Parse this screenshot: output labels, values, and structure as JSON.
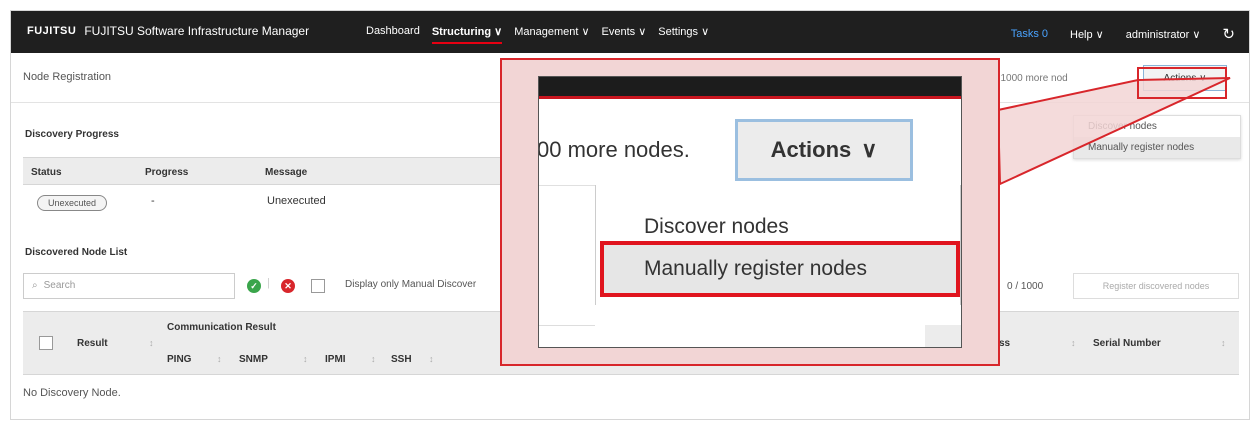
{
  "topbar": {
    "logo": "FUJITSU",
    "app_title": "FUJITSU Software Infrastructure Manager",
    "nav": [
      "Dashboard",
      "Structuring ∨",
      "Management ∨",
      "Events ∨",
      "Settings ∨"
    ],
    "tasks": "Tasks 0",
    "help": "Help ∨",
    "user": "administrator ∨",
    "refresh_icon": "↻",
    "colors": {
      "bar": "#1f1f1f",
      "accent": "#e60012",
      "tasks": "#4aa3ff"
    }
  },
  "page": {
    "title": "Node Registration",
    "note": "ster 1000 more nod",
    "actions_label": "Actions ∨",
    "actions_menu": [
      "Discover nodes",
      "Manually register nodes"
    ]
  },
  "progress": {
    "section_title": "Discovery Progress",
    "headers": [
      "Status",
      "Progress",
      "Message"
    ],
    "row": {
      "status": "Unexecuted",
      "progress": "-",
      "message": "Unexecuted"
    }
  },
  "node_list": {
    "section_title": "Discovered Node List",
    "search_placeholder": "Search",
    "filter_label": "Display only Manual Discover",
    "count": "0 / 1000",
    "register_button": "Register discovered nodes",
    "headers": {
      "result": "Result",
      "communication_result": "Communication Result",
      "ping": "PING",
      "snmp": "SNMP",
      "ipmi": "IPMI",
      "ssh": "SSH",
      "address_tail": "ss",
      "serial_number": "Serial Number"
    },
    "empty_text": "No Discovery Node."
  },
  "zoom": {
    "text_fragment": "00 more nodes.",
    "actions_label": "Actions",
    "menu_item_1": "Discover nodes",
    "menu_item_2": "Manually register nodes",
    "chevron": "∨",
    "highlight_color": "#e0141e"
  }
}
